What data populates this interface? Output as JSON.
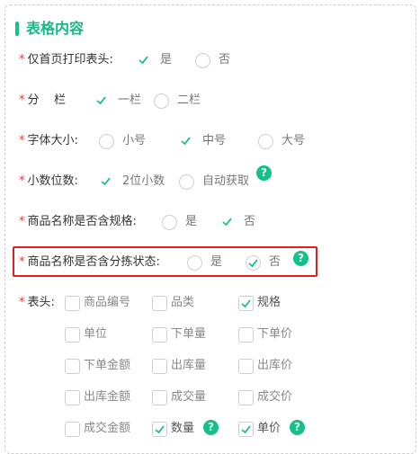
{
  "section": {
    "title": "表格内容"
  },
  "required_mark": "*",
  "help_symbol": "?",
  "colors": {
    "accent": "#16c08a",
    "required": "#e63b3b",
    "highlight": "#e02020"
  },
  "settings": {
    "first_page_header": {
      "label": "仅首页打印表头:",
      "options": [
        "是",
        "否"
      ],
      "selected": "是"
    },
    "columns": {
      "label": "分    栏",
      "options": [
        "一栏",
        "二栏"
      ],
      "selected": "一栏"
    },
    "font_size": {
      "label": "字体大小:",
      "options": [
        "小号",
        "中号",
        "大号"
      ],
      "selected": "中号"
    },
    "decimals": {
      "label": "小数位数:",
      "options": [
        "2位小数",
        "自动获取"
      ],
      "selected": "2位小数"
    },
    "name_spec": {
      "label": "商品名称是否含规格:",
      "options": [
        "是",
        "否"
      ],
      "selected": "否"
    },
    "name_sort_status": {
      "label": "商品名称是否含分拣状态:",
      "options": [
        "是",
        "否"
      ],
      "selected": "否"
    }
  },
  "header_fields": {
    "label": "表头:",
    "items": [
      {
        "label": "商品编号",
        "checked": false
      },
      {
        "label": "品类",
        "checked": false
      },
      {
        "label": "规格",
        "checked": true
      },
      {
        "label": "单位",
        "checked": false
      },
      {
        "label": "下单量",
        "checked": false
      },
      {
        "label": "下单价",
        "checked": false
      },
      {
        "label": "下单金额",
        "checked": false
      },
      {
        "label": "出库量",
        "checked": false
      },
      {
        "label": "出库价",
        "checked": false
      },
      {
        "label": "出库金额",
        "checked": false
      },
      {
        "label": "成交量",
        "checked": false
      },
      {
        "label": "成交价",
        "checked": false
      },
      {
        "label": "成交金额",
        "checked": false
      },
      {
        "label": "数量",
        "checked": true
      },
      {
        "label": "单价",
        "checked": true
      }
    ]
  }
}
